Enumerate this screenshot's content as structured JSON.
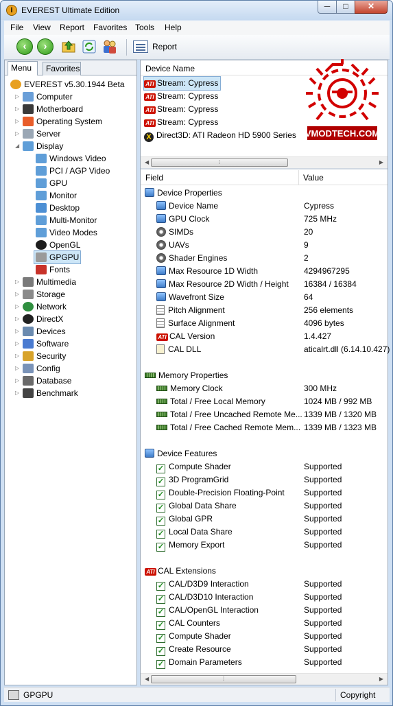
{
  "window": {
    "title": "EVEREST Ultimate Edition",
    "min": "─",
    "max": "□",
    "close": "✕"
  },
  "menu": [
    "File",
    "View",
    "Report",
    "Favorites",
    "Tools",
    "Help"
  ],
  "toolbar": {
    "report_label": "Report",
    "buttons": [
      "back-icon",
      "forward-icon",
      "up-folder-icon",
      "refresh-icon",
      "users-icon"
    ]
  },
  "tabs": {
    "menu": "Menu",
    "favorites": "Favorites"
  },
  "tree": [
    {
      "label": "EVEREST v5.30.1944 Beta",
      "icon": "everest-icon",
      "level": 0
    },
    {
      "label": "Computer",
      "icon": "computer-icon",
      "level": 1
    },
    {
      "label": "Motherboard",
      "icon": "motherboard-icon",
      "level": 1
    },
    {
      "label": "Operating System",
      "icon": "windows-icon",
      "level": 1
    },
    {
      "label": "Server",
      "icon": "server-icon",
      "level": 1
    },
    {
      "label": "Display",
      "icon": "display-icon",
      "level": 1,
      "expanded": true
    },
    {
      "label": "Windows Video",
      "icon": "monitor-icon",
      "level": 2
    },
    {
      "label": "PCI / AGP Video",
      "icon": "monitor-icon",
      "level": 2
    },
    {
      "label": "GPU",
      "icon": "monitor-icon",
      "level": 2
    },
    {
      "label": "Monitor",
      "icon": "monitor-icon",
      "level": 2
    },
    {
      "label": "Desktop",
      "icon": "desktop-icon",
      "level": 2
    },
    {
      "label": "Multi-Monitor",
      "icon": "monitor-icon",
      "level": 2
    },
    {
      "label": "Video Modes",
      "icon": "monitor-icon",
      "level": 2
    },
    {
      "label": "OpenGL",
      "icon": "opengl-icon",
      "level": 2
    },
    {
      "label": "GPGPU",
      "icon": "gpgpu-icon",
      "level": 2,
      "selected": true
    },
    {
      "label": "Fonts",
      "icon": "fonts-icon",
      "level": 2
    },
    {
      "label": "Multimedia",
      "icon": "multimedia-icon",
      "level": 1
    },
    {
      "label": "Storage",
      "icon": "storage-icon",
      "level": 1
    },
    {
      "label": "Network",
      "icon": "network-icon",
      "level": 1
    },
    {
      "label": "DirectX",
      "icon": "directx-icon",
      "level": 1
    },
    {
      "label": "Devices",
      "icon": "devices-icon",
      "level": 1
    },
    {
      "label": "Software",
      "icon": "software-icon",
      "level": 1
    },
    {
      "label": "Security",
      "icon": "security-icon",
      "level": 1
    },
    {
      "label": "Config",
      "icon": "config-icon",
      "level": 1
    },
    {
      "label": "Database",
      "icon": "database-icon",
      "level": 1
    },
    {
      "label": "Benchmark",
      "icon": "benchmark-icon",
      "level": 1
    }
  ],
  "device_header": "Device Name",
  "devices": [
    {
      "name": "Stream: Cypress",
      "icon": "ati-icon",
      "selected": true
    },
    {
      "name": "Stream: Cypress",
      "icon": "ati-icon"
    },
    {
      "name": "Stream: Cypress",
      "icon": "ati-icon"
    },
    {
      "name": "Stream: Cypress",
      "icon": "ati-icon"
    },
    {
      "name": "Direct3D: ATI Radeon HD 5900 Series",
      "icon": "directx-icon"
    }
  ],
  "watermark": "VMODTECH.COM",
  "columns": {
    "field": "Field",
    "value": "Value"
  },
  "rows": [
    {
      "field": "Device Properties",
      "group": true,
      "icon": "gpu-icon"
    },
    {
      "field": "Device Name",
      "value": "Cypress",
      "icon": "gpu-icon"
    },
    {
      "field": "GPU Clock",
      "value": "725 MHz",
      "icon": "gpu-icon"
    },
    {
      "field": "SIMDs",
      "value": "20",
      "icon": "gear-icon"
    },
    {
      "field": "UAVs",
      "value": "9",
      "icon": "gear-icon"
    },
    {
      "field": "Shader Engines",
      "value": "2",
      "icon": "gear-icon"
    },
    {
      "field": "Max Resource 1D Width",
      "value": "4294967295",
      "icon": "gpu-icon"
    },
    {
      "field": "Max Resource 2D Width / Height",
      "value": "16384 / 16384",
      "icon": "gpu-icon"
    },
    {
      "field": "Wavefront Size",
      "value": "64",
      "icon": "gpu-icon"
    },
    {
      "field": "Pitch Alignment",
      "value": "256 elements",
      "icon": "doc-icon"
    },
    {
      "field": "Surface Alignment",
      "value": "4096 bytes",
      "icon": "doc-icon"
    },
    {
      "field": "CAL Version",
      "value": "1.4.427",
      "icon": "ati-icon"
    },
    {
      "field": "CAL DLL",
      "value": "aticalrt.dll (6.14.10.427)",
      "icon": "dll-icon"
    },
    {
      "field": "",
      "spacer": true
    },
    {
      "field": "Memory Properties",
      "group": true,
      "icon": "memory-icon"
    },
    {
      "field": "Memory Clock",
      "value": "300 MHz",
      "icon": "memory-icon"
    },
    {
      "field": "Total / Free Local Memory",
      "value": "1024 MB / 992 MB",
      "icon": "memory-icon"
    },
    {
      "field": "Total / Free Uncached Remote Me...",
      "value": "1339 MB / 1320 MB",
      "icon": "memory-icon"
    },
    {
      "field": "Total / Free Cached Remote Mem...",
      "value": "1339 MB / 1323 MB",
      "icon": "memory-icon"
    },
    {
      "field": "",
      "spacer": true
    },
    {
      "field": "Device Features",
      "group": true,
      "icon": "gpu-icon"
    },
    {
      "field": "Compute Shader",
      "value": "Supported",
      "icon": "check-icon"
    },
    {
      "field": "3D ProgramGrid",
      "value": "Supported",
      "icon": "check-icon"
    },
    {
      "field": "Double-Precision Floating-Point",
      "value": "Supported",
      "icon": "check-icon"
    },
    {
      "field": "Global Data Share",
      "value": "Supported",
      "icon": "check-icon"
    },
    {
      "field": "Global GPR",
      "value": "Supported",
      "icon": "check-icon"
    },
    {
      "field": "Local Data Share",
      "value": "Supported",
      "icon": "check-icon"
    },
    {
      "field": "Memory Export",
      "value": "Supported",
      "icon": "check-icon"
    },
    {
      "field": "",
      "spacer": true
    },
    {
      "field": "CAL Extensions",
      "group": true,
      "icon": "ati-icon"
    },
    {
      "field": "CAL/D3D9 Interaction",
      "value": "Supported",
      "icon": "check-icon"
    },
    {
      "field": "CAL/D3D10 Interaction",
      "value": "Supported",
      "icon": "check-icon"
    },
    {
      "field": "CAL/OpenGL Interaction",
      "value": "Supported",
      "icon": "check-icon"
    },
    {
      "field": "CAL Counters",
      "value": "Supported",
      "icon": "check-icon"
    },
    {
      "field": "Compute Shader",
      "value": "Supported",
      "icon": "check-icon"
    },
    {
      "field": "Create Resource",
      "value": "Supported",
      "icon": "check-icon"
    },
    {
      "field": "Domain Parameters",
      "value": "Supported",
      "icon": "check-icon"
    }
  ],
  "status": {
    "left": "GPGPU",
    "right": "Copyright"
  }
}
